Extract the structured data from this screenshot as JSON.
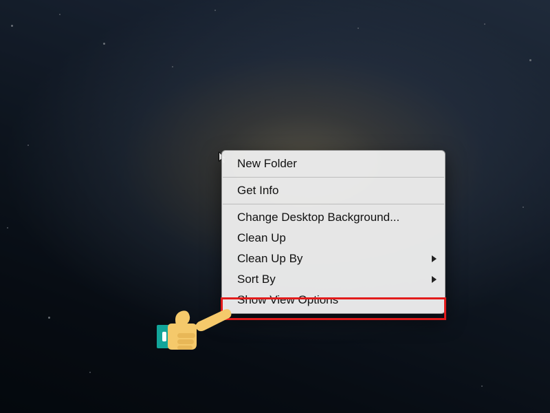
{
  "menu": {
    "items": [
      {
        "label": "New Folder",
        "submenu": false
      },
      {
        "sep": true
      },
      {
        "label": "Get Info",
        "submenu": false
      },
      {
        "sep": true
      },
      {
        "label": "Change Desktop Background...",
        "submenu": false
      },
      {
        "label": "Clean Up",
        "submenu": false
      },
      {
        "label": "Clean Up By",
        "submenu": true
      },
      {
        "label": "Sort By",
        "submenu": true
      },
      {
        "label": "Show View Options",
        "submenu": false
      }
    ]
  },
  "annotation": {
    "highlight_color": "#e21b1b",
    "hand_palm_color": "#f5c96b",
    "hand_cuff_color": "#12a59a"
  }
}
